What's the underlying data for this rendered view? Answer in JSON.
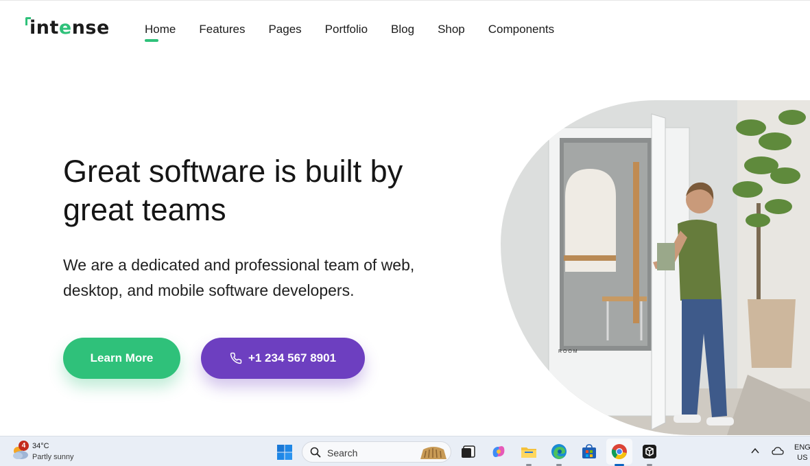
{
  "header": {
    "logo_prefix": "int",
    "logo_accent": "e",
    "logo_suffix": "nse",
    "nav": [
      {
        "label": "Home",
        "active": true
      },
      {
        "label": "Features"
      },
      {
        "label": "Pages"
      },
      {
        "label": "Portfolio"
      },
      {
        "label": "Blog"
      },
      {
        "label": "Shop"
      },
      {
        "label": "Components"
      }
    ]
  },
  "hero": {
    "title_line1": "Great software is built by",
    "title_line2": "great teams",
    "subtitle_line1": "We are a dedicated and professional team of web,",
    "subtitle_line2": "desktop, and mobile software developers.",
    "learn_more": "Learn More",
    "phone": "+1 234 567 8901",
    "booth_text": "R O O M"
  },
  "taskbar": {
    "weather_badge": "4",
    "weather_temp": "34°C",
    "weather_desc": "Partly sunny",
    "search_label": "Search",
    "lang_line1": "ENG",
    "lang_line2": "US",
    "icons": [
      "windows-icon",
      "search-icon",
      "task-view-icon",
      "copilot-icon",
      "file-explorer-icon",
      "edge-icon",
      "store-icon",
      "chrome-icon",
      "app-icon"
    ]
  },
  "colors": {
    "accent_green": "#2fc17a",
    "accent_purple": "#6d3fc0"
  }
}
